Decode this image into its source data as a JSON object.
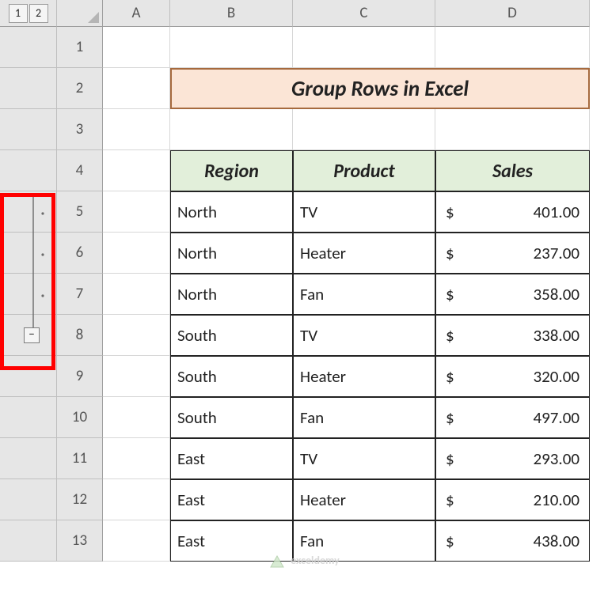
{
  "outline_levels": [
    "1",
    "2"
  ],
  "columns": [
    "A",
    "B",
    "C",
    "D"
  ],
  "row_numbers": [
    "1",
    "2",
    "3",
    "4",
    "5",
    "6",
    "7",
    "8",
    "9",
    "10",
    "11",
    "12",
    "13"
  ],
  "title": "Group Rows in Excel",
  "headers": {
    "region": "Region",
    "product": "Product",
    "sales": "Sales"
  },
  "chart_data": {
    "type": "table",
    "columns": [
      "Region",
      "Product",
      "Sales"
    ],
    "rows": [
      {
        "region": "North",
        "product": "TV",
        "sales": 401.0
      },
      {
        "region": "North",
        "product": "Heater",
        "sales": 237.0
      },
      {
        "region": "North",
        "product": "Fan",
        "sales": 358.0
      },
      {
        "region": "South",
        "product": "TV",
        "sales": 338.0
      },
      {
        "region": "South",
        "product": "Heater",
        "sales": 320.0
      },
      {
        "region": "South",
        "product": "Fan",
        "sales": 497.0
      },
      {
        "region": "East",
        "product": "TV",
        "sales": 293.0
      },
      {
        "region": "East",
        "product": "Heater",
        "sales": 210.0
      },
      {
        "region": "East",
        "product": "Fan",
        "sales": 438.0
      }
    ],
    "currency_symbol": "$"
  },
  "collapse_symbol": "−",
  "watermark_text": "exceldemy"
}
